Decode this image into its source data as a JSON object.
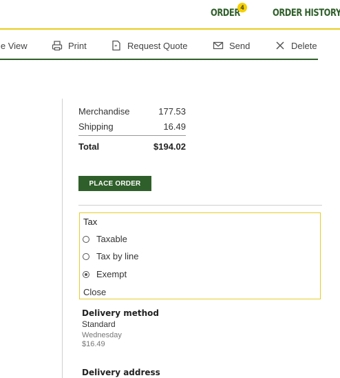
{
  "nav": {
    "order_label": "ORDER",
    "order_badge": "4",
    "history_label": "ORDER HISTORY"
  },
  "toolbar": {
    "view_label": "le View",
    "print_label": "Print",
    "quote_label": "Request Quote",
    "send_label": "Send",
    "delete_label": "Delete"
  },
  "summary": {
    "merch_label": "Merchandise",
    "merch_value": "177.53",
    "ship_label": "Shipping",
    "ship_value": "16.49",
    "total_label": "Total",
    "total_value": "$194.02"
  },
  "place_order_label": "PLACE ORDER",
  "tax": {
    "title": "Tax",
    "options": [
      {
        "label": "Taxable",
        "selected": false
      },
      {
        "label": "Tax by line",
        "selected": false
      },
      {
        "label": "Exempt",
        "selected": true
      }
    ],
    "close_label": "Close"
  },
  "delivery": {
    "method_title": "Delivery method",
    "method_value": "Standard",
    "method_day": "Wednesday",
    "method_price": "$16.49",
    "address_title": "Delivery address"
  },
  "colors": {
    "brand_green": "#2f5f2a",
    "accent_yellow": "#e8cc1c"
  }
}
